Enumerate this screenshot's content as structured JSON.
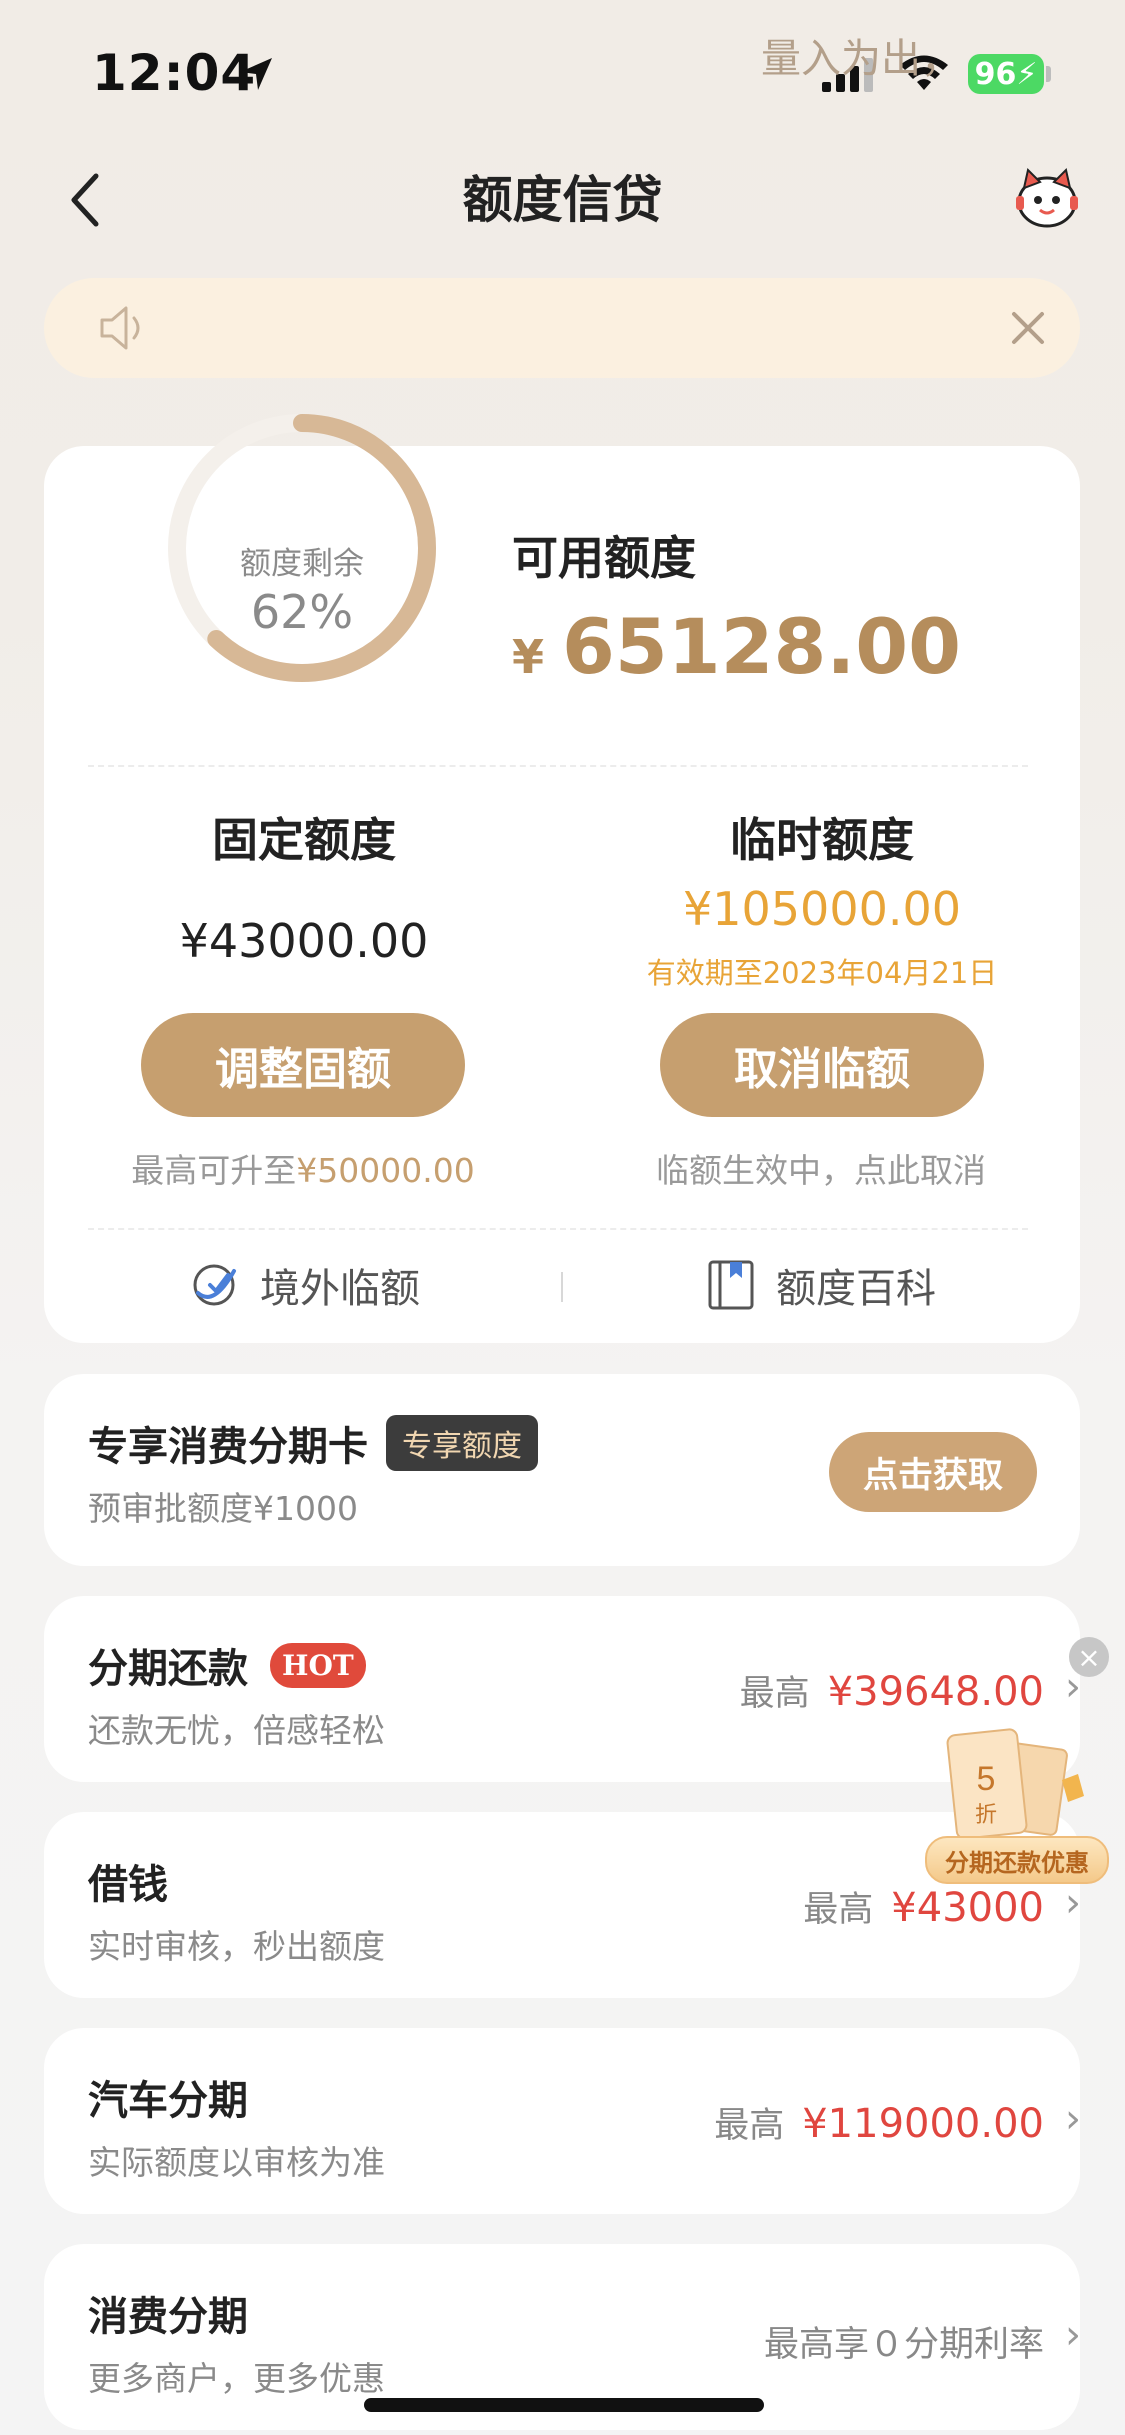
{
  "status_bar": {
    "time": "12:04",
    "battery": "96"
  },
  "nav": {
    "title": "额度信贷"
  },
  "notice": {
    "text": "量入为出，"
  },
  "credit": {
    "remain_label": "额度剩余",
    "remain_percent": "62%",
    "remain_fraction": 0.62,
    "available_label": "可用额度",
    "available_currency": "¥",
    "available_value": "65128.00",
    "fixed": {
      "title": "固定额度",
      "value": "¥43000.00",
      "button": "调整固额",
      "hint_prefix": "最高可升至",
      "hint_amount": "¥50000.00"
    },
    "temporary": {
      "title": "临时额度",
      "value": "¥105000.00",
      "valid": "有效期至2023年04月21日",
      "button": "取消临额",
      "hint": "临额生效中，点此取消"
    },
    "links": {
      "overseas": "境外临额",
      "wiki": "额度百科"
    }
  },
  "exclusive": {
    "title": "专享消费分期卡",
    "tag": "专享额度",
    "sub": "预审批额度¥1000",
    "button": "点击获取"
  },
  "items": [
    {
      "title": "分期还款",
      "tag": "HOT",
      "sub": "还款无忧，倍感轻松",
      "max_label": "最高",
      "max_value": "¥39648.00"
    },
    {
      "title": "借钱",
      "sub": "实时审核，秒出额度",
      "max_label": "最高",
      "max_value": "¥43000"
    },
    {
      "title": "汽车分期",
      "sub": "实际额度以审核为准",
      "max_label": "最高",
      "max_value": "¥119000.00"
    },
    {
      "title": "消费分期",
      "sub": "更多商户，更多优惠",
      "max_text": "最高享０分期利率"
    }
  ],
  "promo": {
    "discount": "5",
    "discount_unit": "折",
    "label": "分期还款优惠"
  },
  "colors": {
    "gold": "#c69f6f",
    "red": "#e0463f",
    "orange": "#e8a437"
  }
}
